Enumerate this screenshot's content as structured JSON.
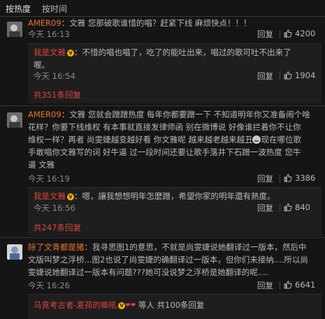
{
  "sort": {
    "hot": "按热度",
    "time": "按时间"
  },
  "actions": {
    "reply": "回复"
  },
  "comments": [
    {
      "user": "AMER09",
      "text": "文雅 您那破歌谁惜的唱？赶紧下线 麻烦快点！！！",
      "time": "今天 16:13",
      "likes": "4200",
      "reply": {
        "user": "我是文雅",
        "text_1": "不惜的唱也唱了，吃了的能吐出来，唱过的歌可吐不出来了",
        "text_2": "喔。",
        "time": "今天 16:54",
        "likes": "1904"
      },
      "total": "共351条回复"
    },
    {
      "user": "AMER09",
      "text_1": "文雅 您就会蹭蹭热度 每年你都要蹭一下 不知道明年你又准备闹个啥",
      "text_2": "花样？你要下线维权 有本事就直接发律师函 别在微博说 好像谁拦着你不让你",
      "text_3": "维权一样？再者 尚雯婕越变越好看 你文雅呢 越来越老越来越丑",
      "text_3b": "现在哪位歌",
      "text_4": "手敢唱你文雅写的词 好牛逼 过一段时间还要让歌手落井下石蹭一波热度 您牛",
      "text_5": "逼 文雅",
      "time": "今天 16:19",
      "likes": "3386",
      "reply": {
        "user": "我是文雅",
        "text": "嗯，讓我想想明年怎麼蹭，希望你家的明年還有熱度。",
        "time": "今天 16:56",
        "likes": "840"
      },
      "total": "共247条回复"
    },
    {
      "user": "除了文青都是猪",
      "text_1": "我寻思图1的意思，不就是尚雯婕说她翻译过一版本，然后中",
      "text_2": "文版叫梦之浮桥...图2也说了尚雯婕的确翻译过一版本，但你们未接纳....所以尚",
      "text_3": "雯婕说她翻译过一版本有问题???她可没说梦之浮桥是她翻译的呢....",
      "time": "今天 16:26",
      "likes": "6641",
      "footer": {
        "user": "马竞考古者-夏荷的嘶吼",
        "rest": "等人 共100条回复"
      }
    }
  ],
  "colors": {
    "background": "#151515",
    "username": "#e8742a",
    "highlight": "#e0433a",
    "text": "#b9b9b9",
    "timestamp": "#8a8a8a"
  }
}
